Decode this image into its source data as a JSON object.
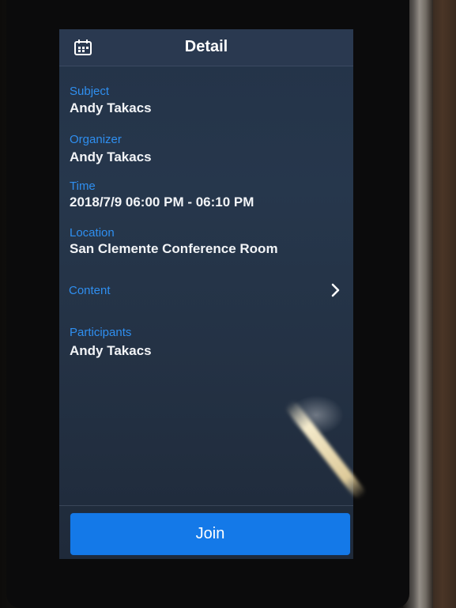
{
  "header": {
    "title": "Detail",
    "icon": "calendar-icon"
  },
  "fields": {
    "subject": {
      "label": "Subject",
      "value": "Andy Takacs"
    },
    "organizer": {
      "label": "Organizer",
      "value": "Andy Takacs"
    },
    "time": {
      "label": "Time",
      "value": "2018/7/9 06:00 PM - 06:10 PM"
    },
    "location": {
      "label": "Location",
      "value": "San Clemente Conference Room"
    },
    "content": {
      "label": "Content",
      "icon": "chevron-right-icon"
    },
    "participants": {
      "label": "Participants",
      "value": "Andy Takacs"
    }
  },
  "footer": {
    "join_label": "Join"
  },
  "colors": {
    "accent": "#2f8ff0",
    "button": "#1479e8",
    "screen_bg": "#243348",
    "text": "#f2f4f7"
  }
}
